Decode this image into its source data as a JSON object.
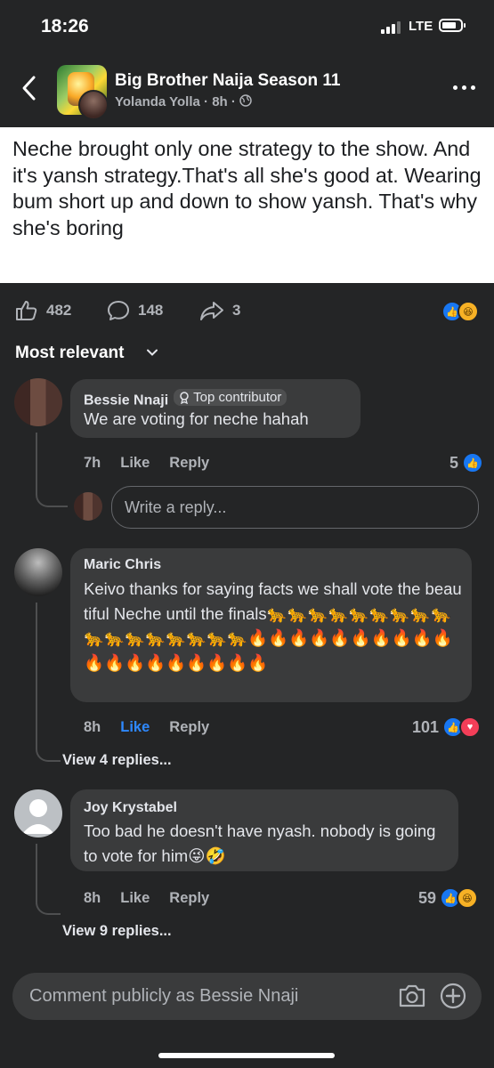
{
  "status_bar": {
    "time": "18:26",
    "network": "LTE"
  },
  "header": {
    "group_name": "Big Brother Naija Season 11",
    "author": "Yolanda Yolla",
    "separator": "·",
    "time": "8h"
  },
  "post": {
    "text": "Neche brought only one strategy to the show. And it's yansh strategy.That's all she's good at. Wearing bum short up and down to show yansh. That's why she's boring"
  },
  "stats": {
    "likes": "482",
    "comments": "148",
    "shares": "3"
  },
  "sort": {
    "label": "Most relevant"
  },
  "comments": [
    {
      "author": "Bessie Nnaji",
      "badge": "Top contributor",
      "text": "We are voting for neche hahah",
      "time": "7h",
      "like": "Like",
      "reply": "Reply",
      "count": "5"
    },
    {
      "author": "Maric Chris",
      "text": "Keivo thanks for saying facts we shall vote the beautiful Neche until the finals🐆🐆🐆🐆🐆🐆🐆🐆🐆🐆🐆🐆🐆🐆🐆🐆🐆🔥🔥🔥🔥🔥🔥🔥🔥🔥🔥🔥🔥🔥🔥🔥🔥🔥🔥🔥",
      "time": "8h",
      "like": "Like",
      "reply": "Reply",
      "count": "101",
      "view_replies": "View 4 replies..."
    },
    {
      "author": "Joy Krystabel",
      "text": "Too bad he doesn't have nyash. nobody is going to vote for him😜🤣",
      "time": "8h",
      "like": "Like",
      "reply": "Reply",
      "count": "59",
      "view_replies": "View 9 replies..."
    }
  ],
  "reply_input": {
    "placeholder": "Write a reply..."
  },
  "comment_bar": {
    "placeholder": "Comment publicly as Bessie Nnaji"
  },
  "icons": {
    "like": "thumbs-up-icon",
    "comment": "speech-bubble-icon",
    "share": "share-arrow-icon",
    "camera": "camera-icon",
    "add": "plus-circle-icon"
  },
  "colors": {
    "background": "#242526",
    "bubble": "#3a3b3c",
    "accent": "#2e89ff",
    "like_reaction": "#1877f2",
    "love_reaction": "#f33e58"
  }
}
